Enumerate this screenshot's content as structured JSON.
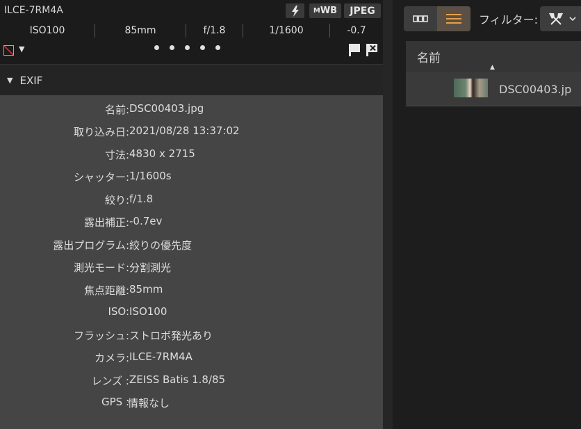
{
  "header": {
    "camera_model": "ILCE-7RM4A",
    "badges": {
      "wb": "WB",
      "format": "JPEG"
    }
  },
  "info_row": [
    "ISO100",
    "85mm",
    "f/1.8",
    "1/1600",
    "-0.7"
  ],
  "rating": {
    "dots": 5
  },
  "exif": {
    "title": "EXIF",
    "rows": [
      {
        "key": "名前:",
        "value": "DSC00403.jpg"
      },
      {
        "key": "取り込み日:",
        "value": "2021/08/28 13:37:02"
      },
      {
        "key": "寸法:",
        "value": "4830 x 2715"
      },
      {
        "key": "シャッター:",
        "value": "1/1600s"
      },
      {
        "key": "絞り:",
        "value": "f/1.8"
      },
      {
        "key": "露出補正:",
        "value": "-0.7ev"
      },
      {
        "key": "露出プログラム:",
        "value": "絞りの優先度"
      },
      {
        "key": "測光モード:",
        "value": "分割測光"
      },
      {
        "key": "焦点距離:",
        "value": "85mm"
      },
      {
        "key": "ISO:",
        "value": "ISO100"
      },
      {
        "key": "フラッシュ:",
        "value": "ストロボ発光あり"
      },
      {
        "key": "カメラ:",
        "value": "ILCE-7RM4A"
      },
      {
        "key": "レンズ :",
        "value": "ZEISS Batis 1.8/85"
      },
      {
        "key": "GPS :",
        "value": "情報なし"
      }
    ]
  },
  "toolbar": {
    "filter_label": "フィルター:"
  },
  "list": {
    "column_name": "名前",
    "files": [
      {
        "name": "DSC00403.jp"
      }
    ]
  },
  "colors": {
    "accent": "#e8a04a",
    "panel": "#454545",
    "header": "#353535"
  }
}
